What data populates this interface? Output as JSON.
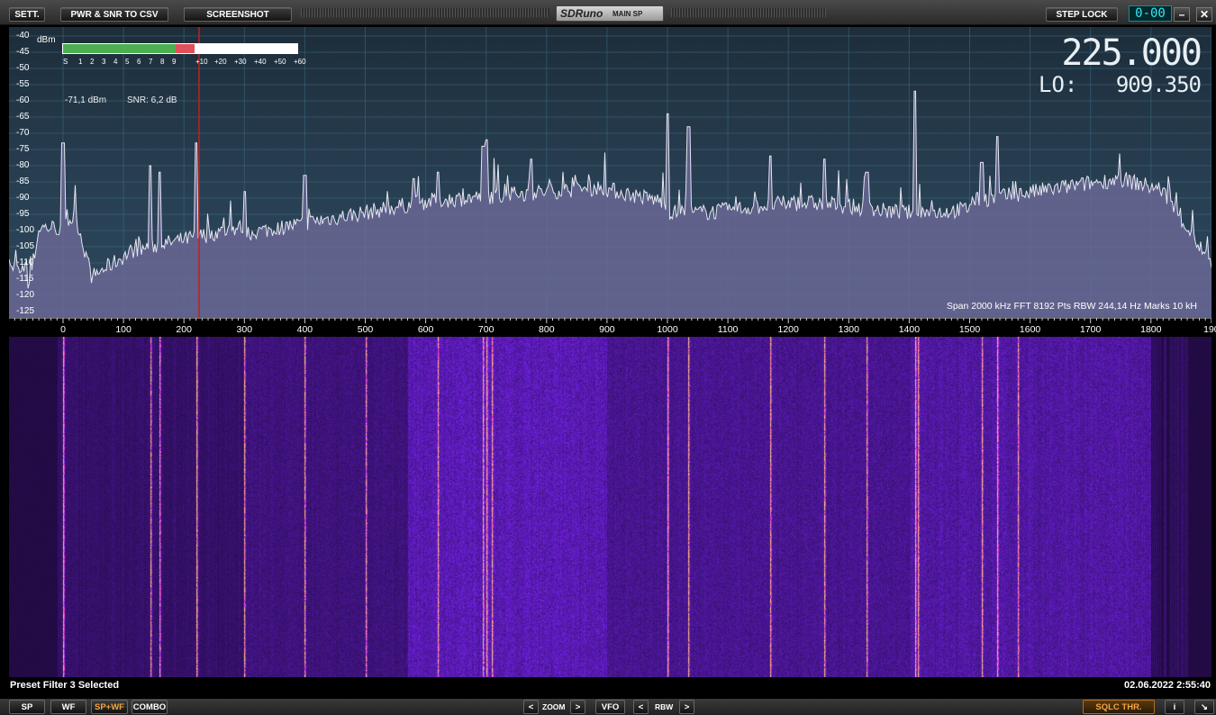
{
  "toolbar": {
    "sett_label": "SETT.",
    "pwr_snr_label": "PWR & SNR TO CSV",
    "screenshot_label": "SCREENSHOT",
    "app_logo": "SDRuno",
    "window_name": "MAIN SP",
    "step_lock_label": "STEP LOCK",
    "digit_display": "0-00",
    "minimize_icon": "minimize-icon",
    "close_icon": "close-icon"
  },
  "spectrum": {
    "unit_label": "dBm",
    "db_ticks": [
      "-40",
      "-45",
      "-50",
      "-55",
      "-60",
      "-65",
      "-70",
      "-75",
      "-80",
      "-85",
      "-90",
      "-95",
      "-100",
      "-105",
      "-110",
      "-115",
      "-120",
      "-125"
    ],
    "s_meter_scale": [
      "S",
      "1",
      "2",
      "3",
      "4",
      "5",
      "6",
      "7",
      "8",
      "9",
      "+10",
      "+20",
      "+30",
      "+40",
      "+50",
      "+60"
    ],
    "s_meter_level_fraction": 0.56,
    "power_readout": "-71,1 dBm",
    "snr_readout": "SNR: 6,2 dB",
    "vfo_frequency": "225.000",
    "lo_label": "LO:",
    "lo_frequency": "909.350",
    "span_info": "Span 2000 kHz   FFT 8192 Pts   RBW 244,14 Hz   Marks 10 kH",
    "colors": {
      "trace": "#e6e6f0",
      "fill": "#6e6a9a",
      "marker": "#c02020",
      "grid": "#3c6b86"
    }
  },
  "axis": {
    "labels": [
      "0",
      "100",
      "200",
      "300",
      "400",
      "500",
      "600",
      "700",
      "800",
      "900",
      "1000",
      "1100",
      "1200",
      "1300",
      "1400",
      "1500",
      "1600",
      "1700",
      "1800",
      "190"
    ]
  },
  "status": {
    "message": "Preset Filter 3 Selected",
    "datetime": "02.06.2022 2:55:40"
  },
  "bottombar": {
    "sp_label": "SP",
    "wf_label": "WF",
    "spwf_label": "SP+WF",
    "combo_label": "COMBO",
    "zoom_left": "<",
    "zoom_label": "ZOOM",
    "zoom_right": ">",
    "vfo_label": "VFO",
    "rbw_left": "<",
    "rbw_label": "RBW",
    "rbw_right": ">",
    "sqlc_label": "SQLC THR.",
    "info_label": "i",
    "resize_icon": "resize-arrow-icon"
  }
}
